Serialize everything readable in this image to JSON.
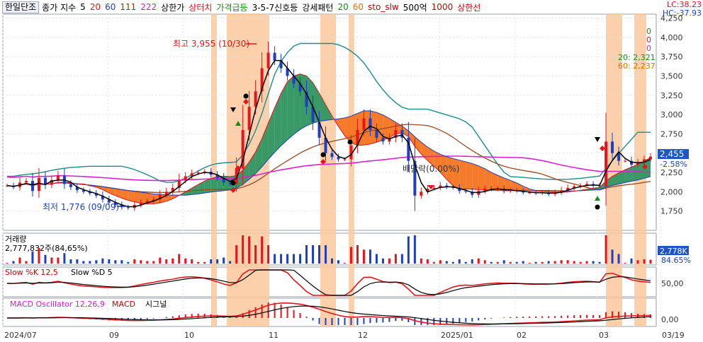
{
  "legend": {
    "symbol": "한일단조",
    "close_label": "종가 지수",
    "ma_periods": [
      "5",
      "20",
      "60",
      "111",
      "222"
    ],
    "items": [
      "상한가",
      "상터치",
      "가격급등",
      "3-5-7신호등",
      "강세패턴",
      "20",
      "60",
      "sto_slw",
      "500억",
      "1000",
      "상한선"
    ]
  },
  "corner": {
    "lc": "LC:38.23",
    "hc": "HC:-37.93"
  },
  "colors": {
    "up": "#e8141c",
    "down": "#1f3fbf",
    "band": "#fcc89b",
    "cloud_up": "#2e9560",
    "cloud_down": "#f4741f",
    "ma_teal": "#1f8b8b",
    "ma_pink": "#dd22cc",
    "ma_brown": "#9b4a20"
  },
  "chart_data": {
    "type": "candlestick",
    "x_ticks": [
      "2024/07",
      "09",
      "10",
      "11",
      "12",
      "2025/01",
      "02",
      "03",
      "03/19"
    ],
    "y_ticks": [
      "4,250",
      "4,000",
      "3,750",
      "3,500",
      "3,250",
      "3,000",
      "2,750",
      "2,500",
      "2,250",
      "2,000",
      "1,750"
    ],
    "ylim": [
      1500,
      4300
    ],
    "annotations": {
      "high": "최고 3,955 (10/30)",
      "low": "최저 1,776 (09/09)",
      "pattern": "배당락(0.00%)"
    },
    "right_labels": {
      "ma20": "20: 2,321",
      "ma60": "60: 2,237",
      "price": "2,455",
      "pct": "-2.58%",
      "z1": "0",
      "z2": "0",
      "z3": "0"
    },
    "close": [
      2080,
      2060,
      2120,
      2140,
      2010,
      2180,
      2090,
      2150,
      2210,
      2100,
      2060,
      2020,
      2000,
      1980,
      1950,
      1900,
      1860,
      1830,
      1800,
      1790,
      1830,
      1860,
      1880,
      1900,
      1960,
      2000,
      2050,
      2150,
      2200,
      2240,
      2250,
      2260,
      2220,
      2180,
      2120,
      2100,
      2300,
      2800,
      3100,
      3300,
      3600,
      3800,
      3700,
      3600,
      3500,
      3400,
      3300,
      3100,
      2900,
      2700,
      2500,
      2450,
      2420,
      2420,
      2600,
      2800,
      2950,
      2800,
      2700,
      2650,
      2700,
      2800,
      2700,
      2400,
      1950,
      2000,
      2040,
      2050,
      2080,
      2060,
      2050,
      2010,
      2000,
      1960,
      2010,
      2040,
      2030,
      2040,
      2010,
      2020,
      2010,
      1990,
      1990,
      1980,
      1990,
      1970,
      1990,
      2020,
      2050,
      2070,
      2080,
      2100,
      2080,
      2070,
      2650,
      2500,
      2400,
      2400,
      2350,
      2380,
      2420,
      2455
    ],
    "highs": [
      {
        "x": "10/30",
        "v": 3955
      }
    ],
    "volume": {
      "title": "거래량",
      "value_text": "2,777,832주(84,65%)",
      "right_value": "2,778K",
      "right_pct": "84.65%"
    },
    "stoch": {
      "title": "Slow %K 12,5",
      "title2": "Slow %D 5",
      "tick": "50,00"
    },
    "macd": {
      "title": "MACD Oscillator 12,26,9",
      "title2": "MACD",
      "title3": "시그널",
      "tick": "0,00"
    }
  }
}
